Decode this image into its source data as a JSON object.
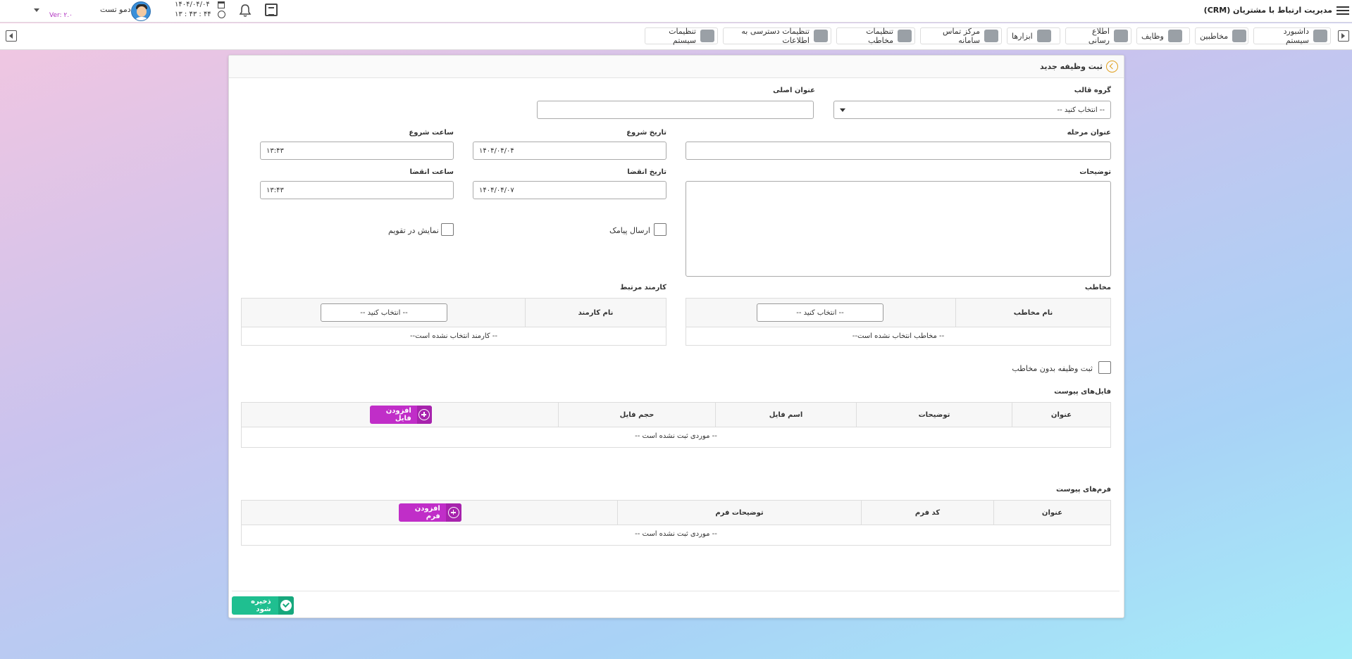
{
  "app": {
    "title": "مدیریت ارتباط با مشتریان (CRM)",
    "user_name": "دمو تست",
    "version": "Ver: ۲.۰",
    "date": "۱۴۰۴/۰۴/۰۴",
    "time": "۱۳ : ۴۳ : ۴۴"
  },
  "nav": {
    "items": [
      {
        "label": "داشبورد سیستم",
        "icon": "gauge-icon"
      },
      {
        "label": "مخاطبین",
        "icon": "contacts-icon"
      },
      {
        "label": "وظایف",
        "icon": "bell-icon"
      },
      {
        "label": "اطلاع رسانی",
        "icon": "envelope-icon"
      },
      {
        "label": "ابزارها",
        "icon": "tools-icon"
      },
      {
        "label": "مرکز تماس سامانه",
        "icon": "fax-icon"
      },
      {
        "label": "تنظیمات مخاطب",
        "icon": "user-gear-icon"
      },
      {
        "label": "تنظیمات دسترسی به اطلاعات",
        "icon": "key-icon"
      },
      {
        "label": "تنظیمات سیستم",
        "icon": "gears-icon"
      }
    ]
  },
  "page": {
    "title": "ثبت وظیفه جدید"
  },
  "form": {
    "template_group_label": "گروه قالب",
    "template_group_value": "-- انتخاب کنید --",
    "main_title_label": "عنوان اصلی",
    "main_title_value": "",
    "stage_title_label": "عنوان مرحله",
    "stage_title_value": "",
    "start_date_label": "تاریخ شروع",
    "start_date_value": "۱۴۰۴/۰۴/۰۴",
    "start_time_label": "ساعت شروع",
    "start_time_value": "۱۳:۴۳",
    "description_label": "توضیحات",
    "description_value": "",
    "end_date_label": "تاریخ انقضا",
    "end_date_value": "۱۴۰۴/۰۴/۰۷",
    "end_time_label": "ساعت انقضا",
    "end_time_value": "۱۳:۴۳",
    "send_sms_label": "ارسال پیامک",
    "show_calendar_label": "نمایش در تقویم",
    "contact_label": "مخاطب",
    "contact_col": "نام مخاطب",
    "contact_select": "-- انتخاب کنید --",
    "contact_empty": "-- مخاطب انتخاب نشده است--",
    "employee_label": "کارمند مرتبط",
    "employee_col": "نام کارمند",
    "employee_select": "-- انتخاب کنید --",
    "employee_empty": "-- کارمند انتخاب نشده است--",
    "no_contact_label": "ثبت وظیفه بدون مخاطب"
  },
  "files": {
    "section_label": "فایل‌های پیوست",
    "columns": [
      "عنوان",
      "توضیحات",
      "اسم فایل",
      "حجم فایل"
    ],
    "add_label": "افزودن فایل",
    "empty": "-- موردی ثبت نشده است --"
  },
  "forms": {
    "section_label": "فرم‌های پیوست",
    "columns": [
      "عنوان",
      "کد فرم",
      "توضیحات فرم"
    ],
    "add_label": "افزودن فرم",
    "empty": "-- موردی ثبت نشده است --"
  },
  "save_label": "ذخیره شود",
  "colors": {
    "add_button": "#c02ec8",
    "save_button": "#1fbf90",
    "version_text": "#b030c0"
  }
}
